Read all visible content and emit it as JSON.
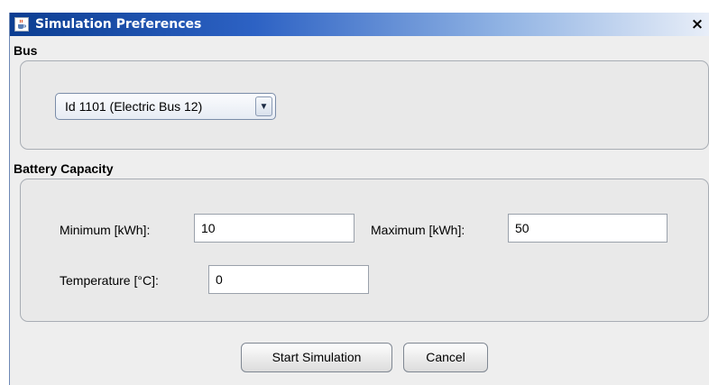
{
  "window": {
    "title": "Simulation Preferences",
    "icon": "java-cup-icon",
    "close_label": "×"
  },
  "bus_section": {
    "label": "Bus",
    "selected_bus": "Id 1101 (Electric Bus 12)",
    "dropdown_arrow": "▼"
  },
  "battery_section": {
    "label": "Battery Capacity",
    "minimum_label": "Minimum [kWh]:",
    "minimum_value": "10",
    "maximum_label": "Maximum [kWh]:",
    "maximum_value": "50",
    "temperature_label": "Temperature [°C]:",
    "temperature_value": "0"
  },
  "buttons": {
    "start_label": "Start Simulation",
    "cancel_label": "Cancel"
  }
}
